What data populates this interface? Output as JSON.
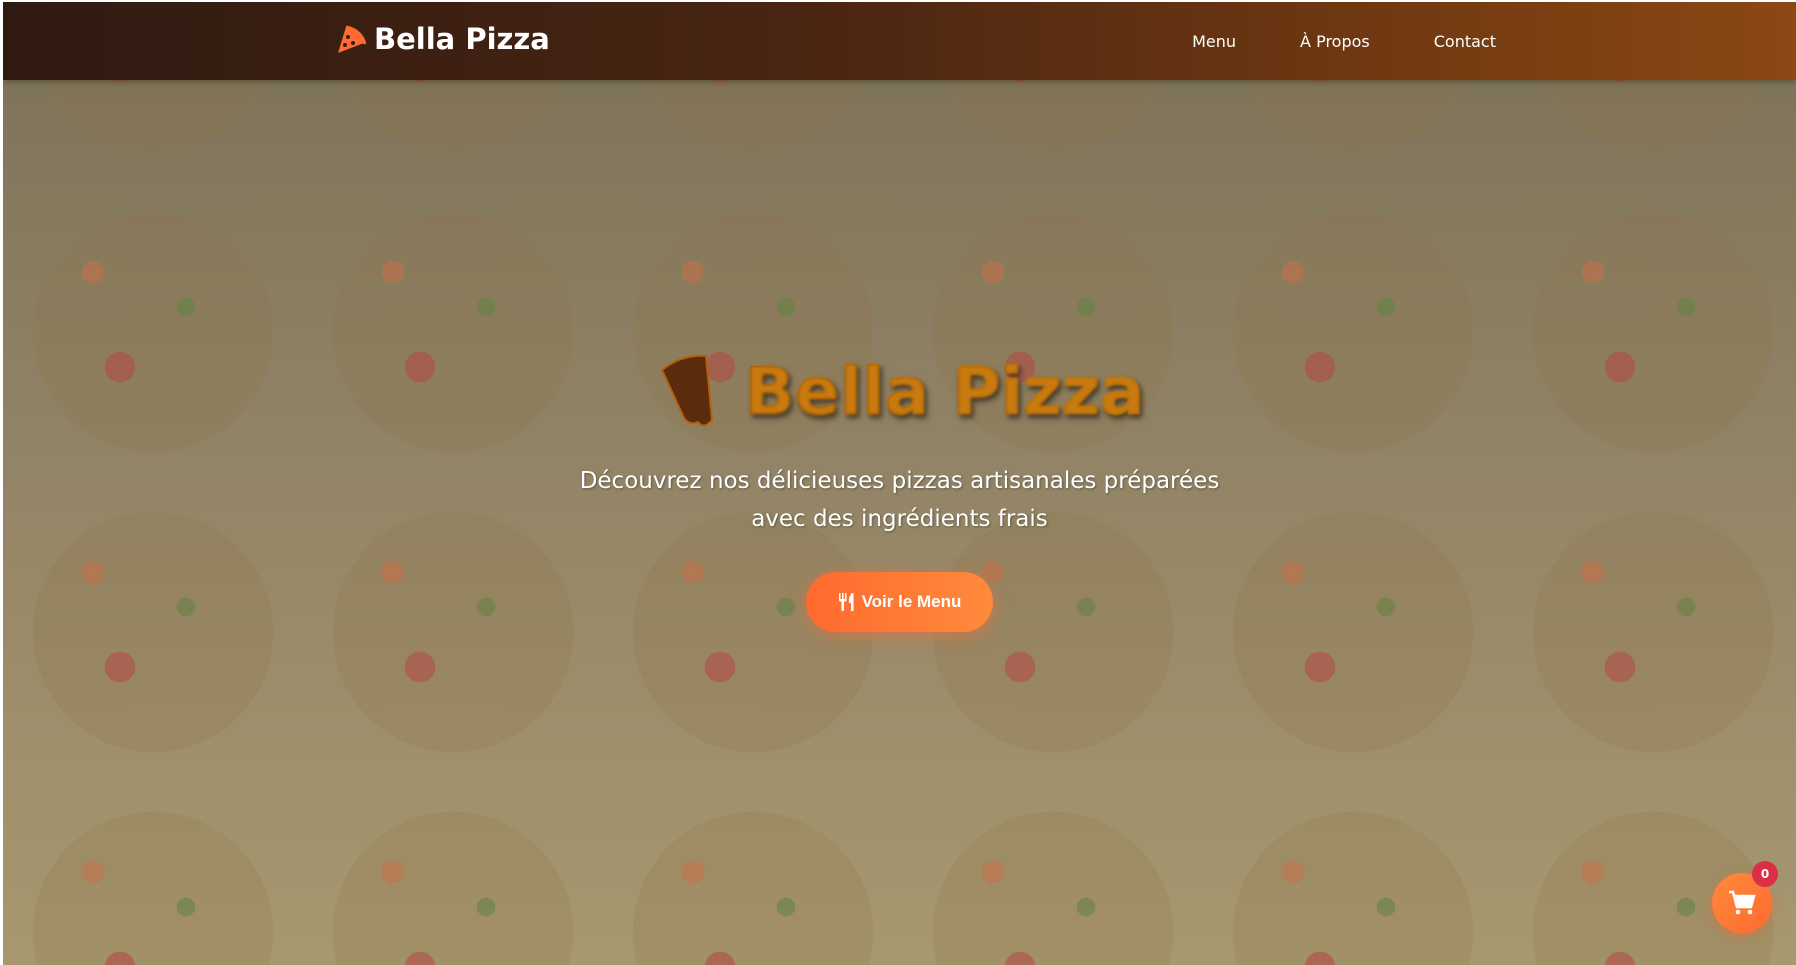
{
  "nav": {
    "brand": "Bella Pizza",
    "links": [
      "Menu",
      "À Propos",
      "Contact"
    ]
  },
  "hero": {
    "title": "Bella Pizza",
    "subtitle": "Découvrez nos délicieuses pizzas artisanales préparées avec des ingrédients frais",
    "cta": "Voir le Menu"
  },
  "cart": {
    "count": "0"
  },
  "colors": {
    "accent": "#ff6b35",
    "badge": "#dc2f45",
    "nav_start": "#2f1a12",
    "nav_end": "#8c4714"
  },
  "icons": {
    "logo": "pizza-slice-icon",
    "cta": "utensils-icon",
    "cart": "shopping-cart-icon"
  }
}
